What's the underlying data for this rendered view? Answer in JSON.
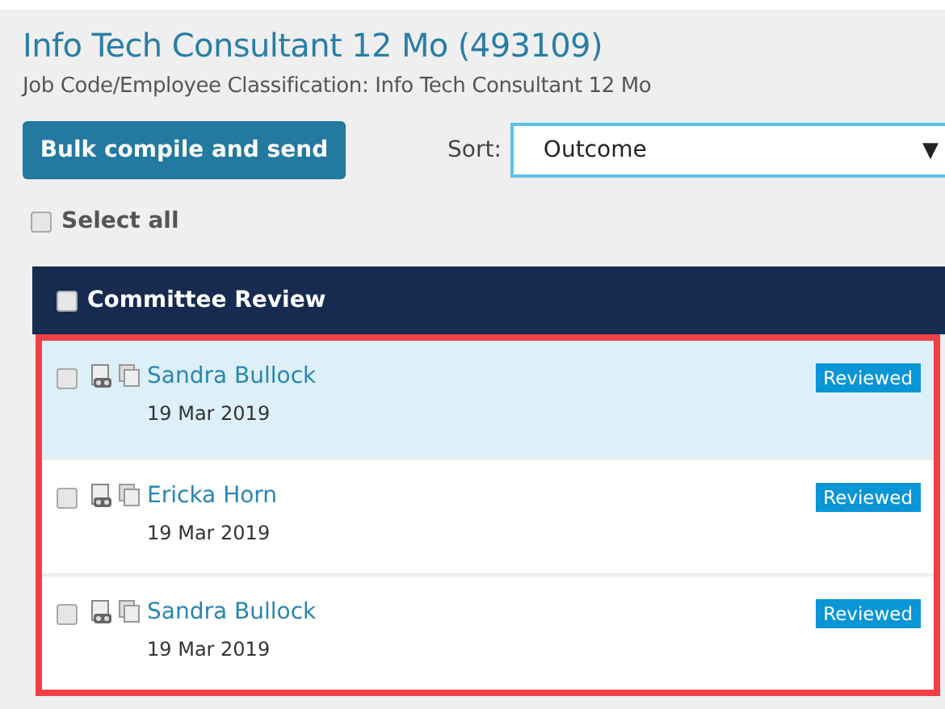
{
  "header": {
    "title": "Info Tech Consultant 12 Mo (493109)",
    "subtitle": "Job Code/Employee Classification: Info Tech Consultant 12 Mo"
  },
  "toolbar": {
    "button": "Bulk compile and send",
    "sort_label": "Sort:",
    "sort_value": "Outcome",
    "sort_caret": "▼"
  },
  "select_all": {
    "label": "Select all",
    "checked": false
  },
  "panel": {
    "title": "Committee Review",
    "checked": false,
    "rows": [
      {
        "name": "Sandra Bullock",
        "date": "19 Mar 2019",
        "status": "Reviewed",
        "checked": false,
        "selected": true
      },
      {
        "name": "Ericka Horn",
        "date": "19 Mar 2019",
        "status": "Reviewed",
        "checked": false,
        "selected": false
      },
      {
        "name": "Sandra Bullock",
        "date": "19 Mar 2019",
        "status": "Reviewed",
        "checked": false,
        "selected": false
      }
    ]
  }
}
